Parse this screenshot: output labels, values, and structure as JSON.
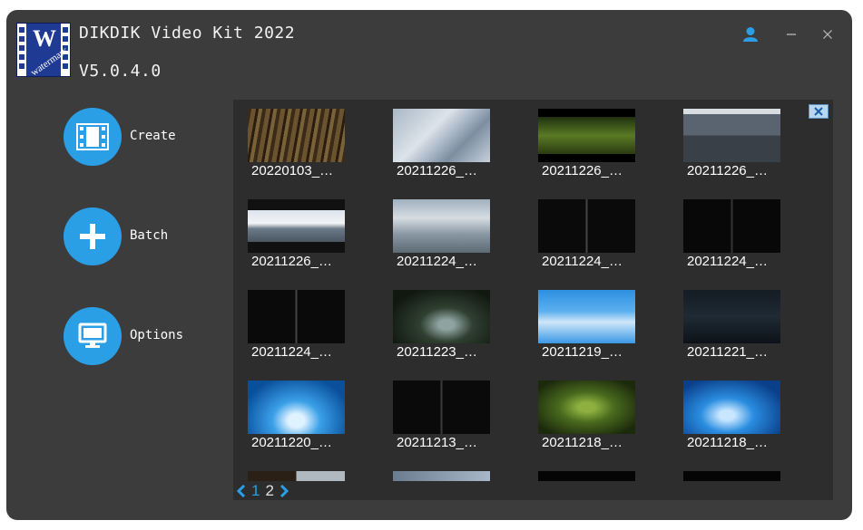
{
  "app": {
    "title": "DIKDIK Video Kit 2022",
    "version": "V5.0.4.0",
    "logo_letter": "W",
    "logo_text": "watermark",
    "accent": "#2a9fe6"
  },
  "sidebar": {
    "items": [
      {
        "label": "Create",
        "icon": "film-icon"
      },
      {
        "label": "Batch",
        "icon": "plus-icon"
      },
      {
        "label": "Options",
        "icon": "monitor-icon"
      }
    ]
  },
  "thumbnails": [
    {
      "label": "20220103_…"
    },
    {
      "label": "20211226_…"
    },
    {
      "label": "20211226_…"
    },
    {
      "label": "20211226_…"
    },
    {
      "label": "20211226_…"
    },
    {
      "label": "20211224_…"
    },
    {
      "label": "20211224_…"
    },
    {
      "label": "20211224_…"
    },
    {
      "label": "20211224_…"
    },
    {
      "label": "20211223_…"
    },
    {
      "label": "20211219_…"
    },
    {
      "label": "20211221_…"
    },
    {
      "label": "20211220_…"
    },
    {
      "label": "20211213_…"
    },
    {
      "label": "20211218_…"
    },
    {
      "label": "20211218_…"
    }
  ],
  "pagination": {
    "pages": [
      "1",
      "2"
    ],
    "current": "1"
  }
}
